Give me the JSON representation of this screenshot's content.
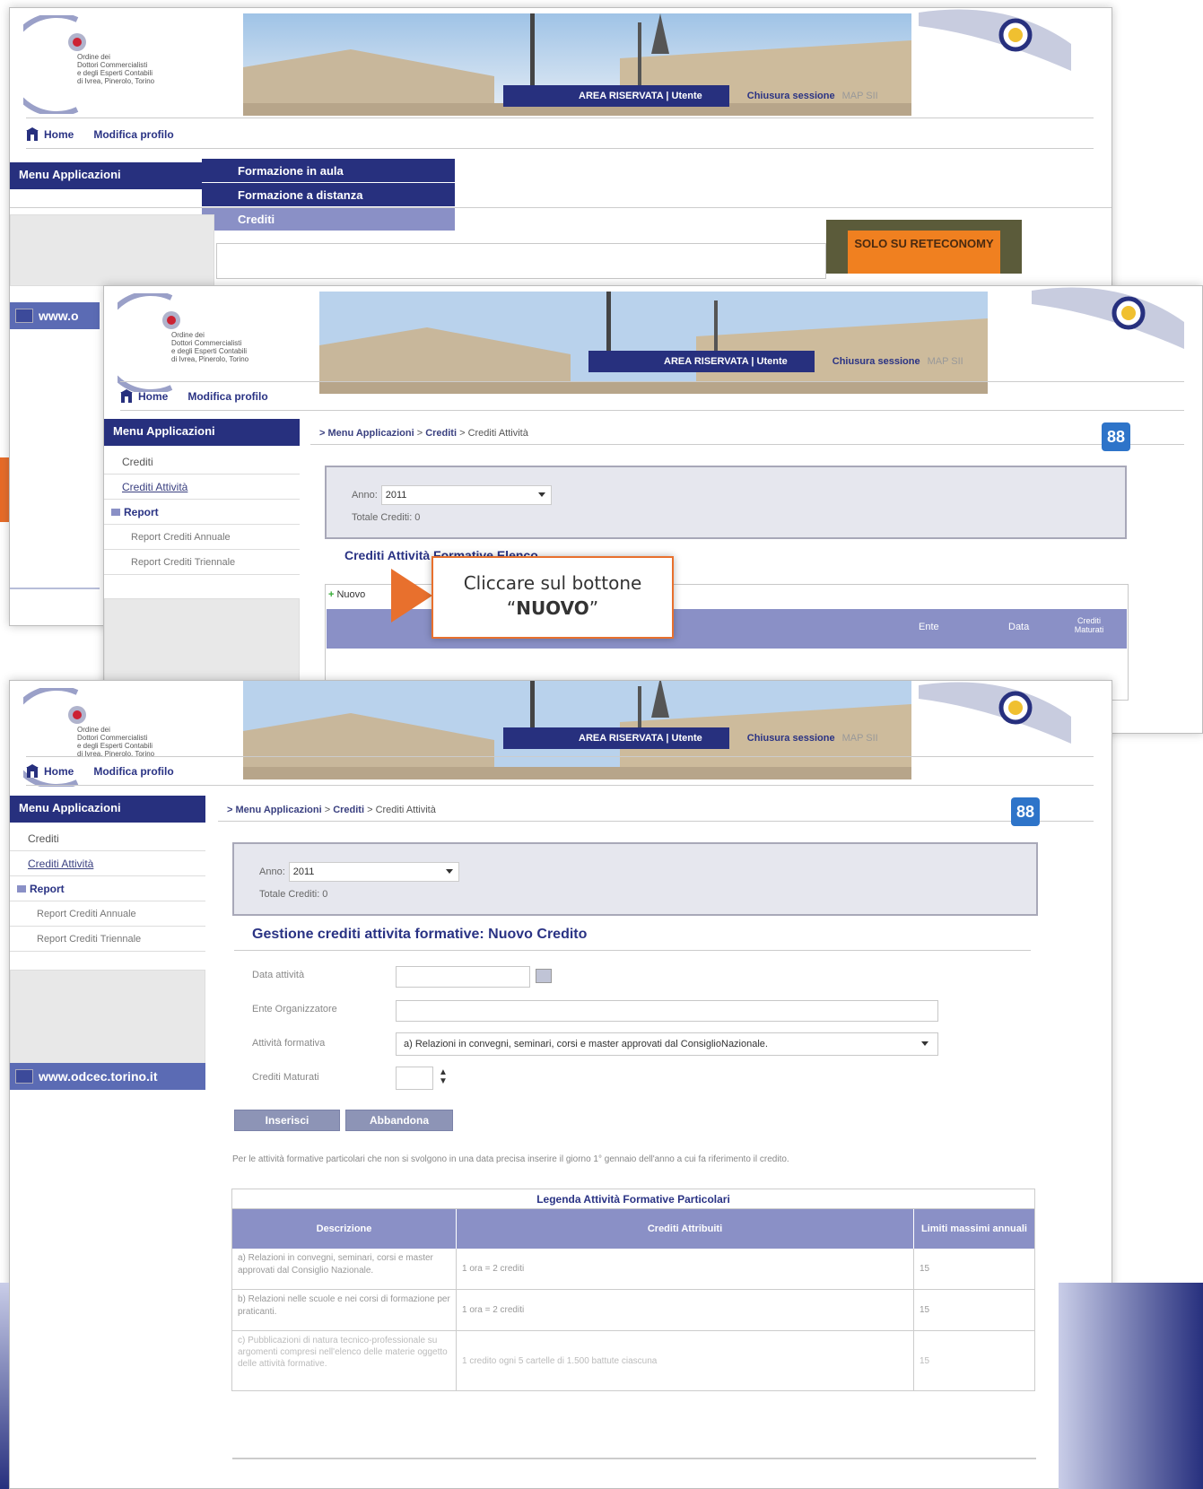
{
  "header": {
    "logo_lines": [
      "Ordine dei",
      "Dottori Commercialisti",
      "e degli Esperti Contabili",
      "di Ivrea, Pinerolo, Torino"
    ],
    "area_riservata": "AREA RISERVATA | Utente",
    "chiusura": "Chiusura sessione",
    "map": "MAP SII"
  },
  "nav": {
    "home": "Home",
    "profilo": "Modifica profilo"
  },
  "menu": {
    "title": "Menu Applicazioni",
    "dropdown": [
      "Formazione in aula",
      "Formazione a distanza",
      "Crediti"
    ]
  },
  "promo": {
    "text": "SOLO SU RETECONOMY"
  },
  "sidebar": {
    "crediti": "Crediti",
    "crediti_attivita": "Crediti Attività",
    "report": "Report",
    "report_annuale": "Report Crediti Annuale",
    "report_triennale": "Report Crediti Triennale",
    "www": "www.odcec.torino.it",
    "www_short": "www.o"
  },
  "breadcrumb": {
    "a": "> Menu Applicazioni",
    "b": "Crediti",
    "c": "Crediti Attività"
  },
  "icon88": "88",
  "filter": {
    "anno_label": "Anno:",
    "anno_value": "2011",
    "totale": "Totale Crediti: 0"
  },
  "list": {
    "title_partial": "Crediti Attività Formative Elenco",
    "nuovo": "Nuovo",
    "cols": [
      "Ente",
      "Data",
      "Crediti Maturati"
    ]
  },
  "callout": {
    "line1": "Cliccare sul bottone",
    "line2_pre": "“",
    "line2_b": "NUOVO",
    "line2_post": "”"
  },
  "form": {
    "title": "Gestione crediti attivita formative: Nuovo Credito",
    "data_label": "Data attività",
    "ente_label": "Ente Organizzatore",
    "attivita_label": "Attività formativa",
    "attivita_value": "a) Relazioni in convegni, seminari, corsi e master approvati dal ConsiglioNazionale.",
    "crediti_label": "Crediti Maturati",
    "btn_inserisci": "Inserisci",
    "btn_abbandona": "Abbandona",
    "note": "Per le attività formative particolari che non si svolgono in una data precisa inserire il giorno 1° gennaio dell'anno a cui fa riferimento il credito."
  },
  "legend": {
    "caption": "Legenda Attività Formative Particolari",
    "headers": [
      "Descrizione",
      "Crediti Attribuiti",
      "Limiti massimi annuali"
    ],
    "rows": [
      {
        "desc": "a) Relazioni in convegni, seminari, corsi e master approvati dal Consiglio Nazionale.",
        "crediti": "1 ora = 2 crediti",
        "limite": "15"
      },
      {
        "desc": "b) Relazioni nelle scuole e nei corsi di formazione per praticanti.",
        "crediti": "1 ora = 2 crediti",
        "limite": "15"
      },
      {
        "desc": "c) Pubblicazioni di natura tecnico-professionale su argomenti compresi nell'elenco delle materie oggetto delle attività formative.",
        "crediti": "1 credito ogni 5 cartelle di 1.500 battute ciascuna",
        "limite": "15"
      }
    ]
  },
  "colors": {
    "navy": "#27307e",
    "lavender": "#8a90c6",
    "orange": "#e8702d"
  }
}
